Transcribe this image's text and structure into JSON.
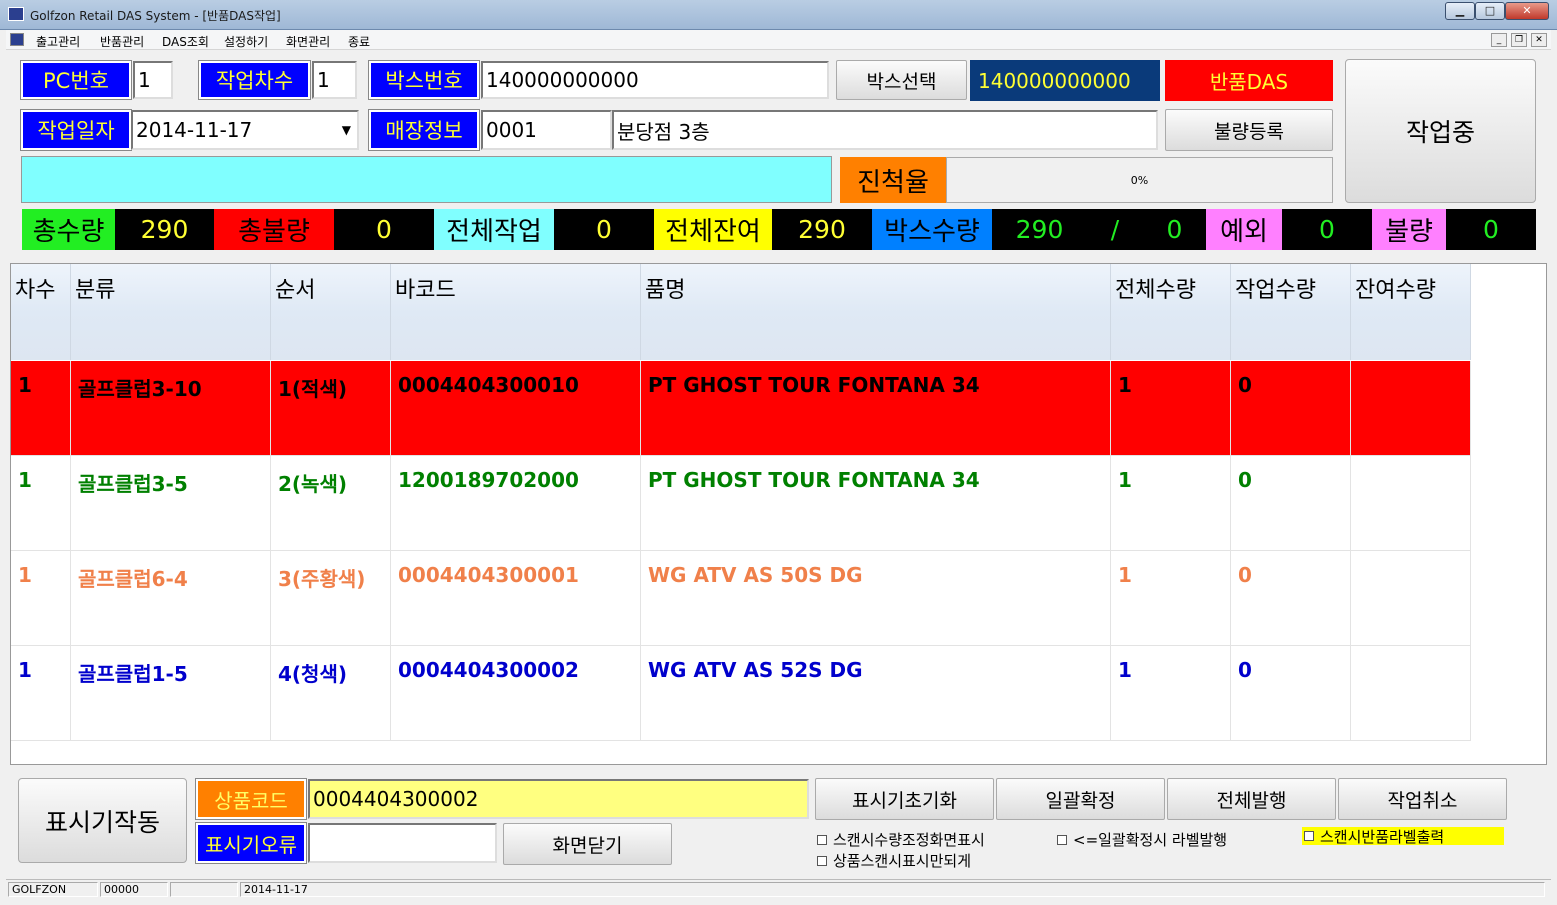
{
  "window": {
    "title": "Golfzon Retail DAS System - [반품DAS작업]",
    "min": "▁",
    "max": "□",
    "close": "✕"
  },
  "menu": [
    "출고관리",
    "반품관리",
    "DAS조회",
    "설정하기",
    "화면관리",
    "종료"
  ],
  "header": {
    "pc_label": "PC번호",
    "pc_value": "1",
    "batch_label": "작업차수",
    "batch_value": "1",
    "box_label": "박스번호",
    "box_value": "140000000000",
    "box_select_button": "박스선택",
    "box_selected_value": "140000000000",
    "mode_badge": "반품DAS",
    "working_status": "작업중",
    "date_label": "작업일자",
    "date_value": "2014-11-17",
    "store_label": "매장정보",
    "store_code": "0001",
    "store_name": "분당점 3층",
    "defect_register_button": "불량등록",
    "progress_label": "진척율",
    "progress_text": "0%",
    "progress_fraction": 0
  },
  "stats": {
    "total_qty_label": "총수량",
    "total_qty": "290",
    "total_defect_label": "총불량",
    "total_defect": "0",
    "all_work_label": "전체작업",
    "all_work": "0",
    "all_remain_label": "전체잔여",
    "all_remain": "290",
    "box_qty_label": "박스수량",
    "box_qty_a": "290",
    "box_qty_sep": "/",
    "box_qty_b": "0",
    "exception_label": "예외",
    "exception": "0",
    "defect_label": "불량",
    "defect": "0"
  },
  "table": {
    "columns": [
      "차수",
      "분류",
      "순서",
      "바코드",
      "품명",
      "전체수량",
      "작업수량",
      "잔여수량"
    ],
    "rows": [
      {
        "cells": [
          "1",
          "골프클럽3-10",
          "1(적색)",
          "0004404300010",
          "PT GHOST TOUR FONTANA 34",
          "1",
          "0",
          ""
        ],
        "color": "#000000",
        "bg": "#ff0000"
      },
      {
        "cells": [
          "1",
          "골프클럽3-5",
          "2(녹색)",
          "1200189702000",
          "PT GHOST TOUR FONTANA 34",
          "1",
          "0",
          ""
        ],
        "color": "#008000",
        "bg": "#ffffff"
      },
      {
        "cells": [
          "1",
          "골프클럽6-4",
          "3(주황색)",
          "0004404300001",
          "WG ATV AS 50S DG",
          "1",
          "0",
          ""
        ],
        "color": "#f0804a",
        "bg": "#ffffff"
      },
      {
        "cells": [
          "1",
          "골프클럽1-5",
          "4(청색)",
          "0004404300002",
          "WG ATV AS 52S DG",
          "1",
          "0",
          ""
        ],
        "color": "#0000cc",
        "bg": "#ffffff"
      }
    ]
  },
  "bottom": {
    "display_run_button": "표시기작동",
    "product_code_label": "상품코드",
    "product_code_value": "0004404300002",
    "display_error_label": "표시기오류",
    "display_error_value": "",
    "close_screen_button": "화면닫기",
    "display_init_button": "표시기초기화",
    "batch_confirm_button": "일괄확정",
    "issue_all_button": "전체발행",
    "cancel_work_button": "작업취소",
    "chk_scan_qty_adjust": "스캔시수량조정화면표시",
    "chk_scan_display_only": "상품스캔시표시만되게",
    "chk_label_on_confirm": "<=일괄확정시 라벨발행",
    "chk_scan_return_label": "스캔시반품라벨출력"
  },
  "statusbar": {
    "company": "GOLFZON",
    "code": "00000",
    "blank": "",
    "date": "2014-11-17"
  }
}
